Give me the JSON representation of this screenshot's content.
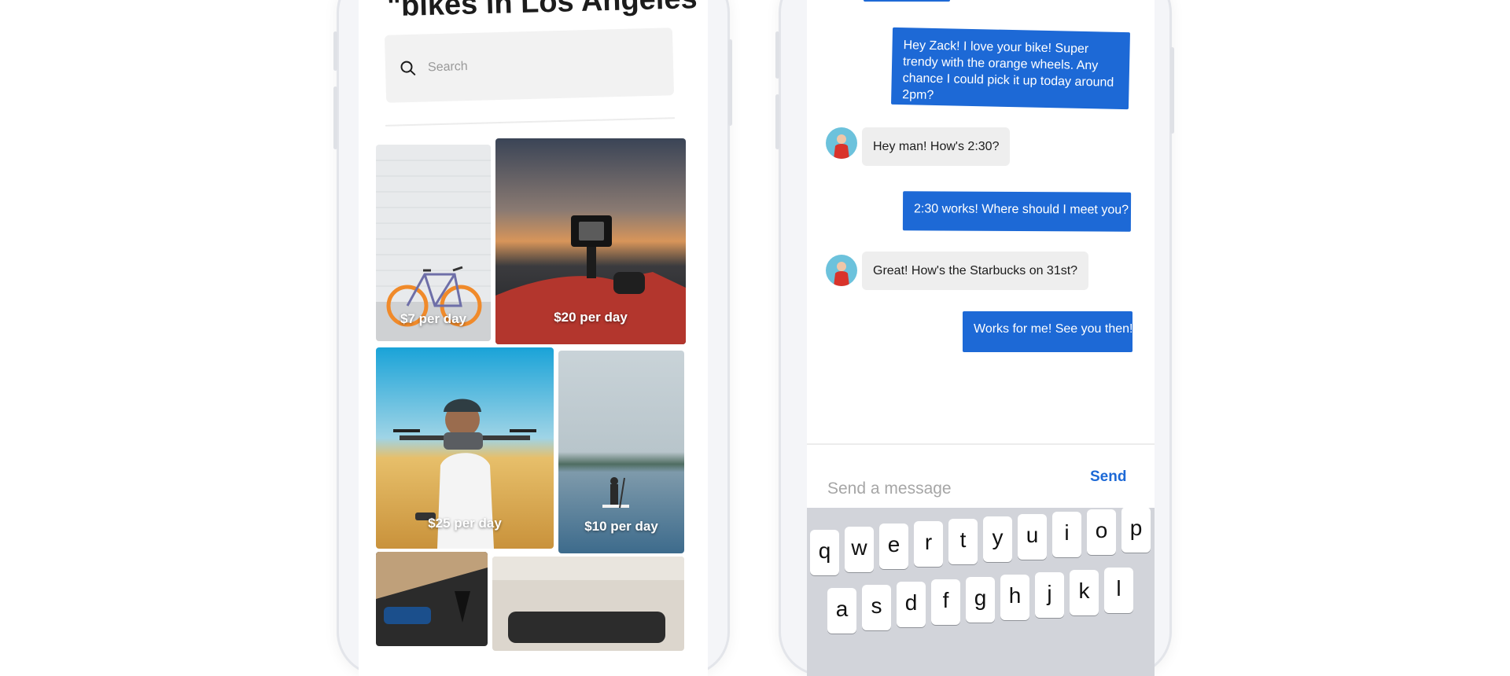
{
  "listing": {
    "title": "\"bikes in Los Angeles\"",
    "search_placeholder": "Search",
    "items": [
      {
        "price": "$7 per day",
        "subject": "bicycle"
      },
      {
        "price": "$20 per day",
        "subject": "action camera"
      },
      {
        "price": "$25 per day",
        "subject": "drone"
      },
      {
        "price": "$10 per day",
        "subject": "paddle board"
      },
      {
        "price": "",
        "subject": "tools"
      },
      {
        "price": "",
        "subject": "furniture"
      }
    ]
  },
  "chat": {
    "messages": [
      {
        "from": "me",
        "text": "Hey Zack! I love your bike! Super trendy with the orange wheels. Any chance I could pick it up today around 2pm?"
      },
      {
        "from": "them",
        "text": "Hey man! How's 2:30?"
      },
      {
        "from": "me",
        "text": "2:30 works! Where should I meet you?"
      },
      {
        "from": "them",
        "text": "Great! How's the Starbucks on 31st?"
      },
      {
        "from": "me",
        "text": "Works for me! See you then!"
      }
    ],
    "compose_placeholder": "Send a message",
    "send_label": "Send"
  },
  "keyboard": {
    "row1": [
      "q",
      "w",
      "e",
      "r",
      "t",
      "y",
      "u",
      "i",
      "o",
      "p"
    ],
    "row2": [
      "a",
      "s",
      "d",
      "f",
      "g",
      "h",
      "j",
      "k",
      "l"
    ]
  },
  "colors": {
    "accent_blue": "#1d69d6",
    "incoming_bubble": "#eeeeee",
    "keyboard_bg": "#d2d4da"
  }
}
